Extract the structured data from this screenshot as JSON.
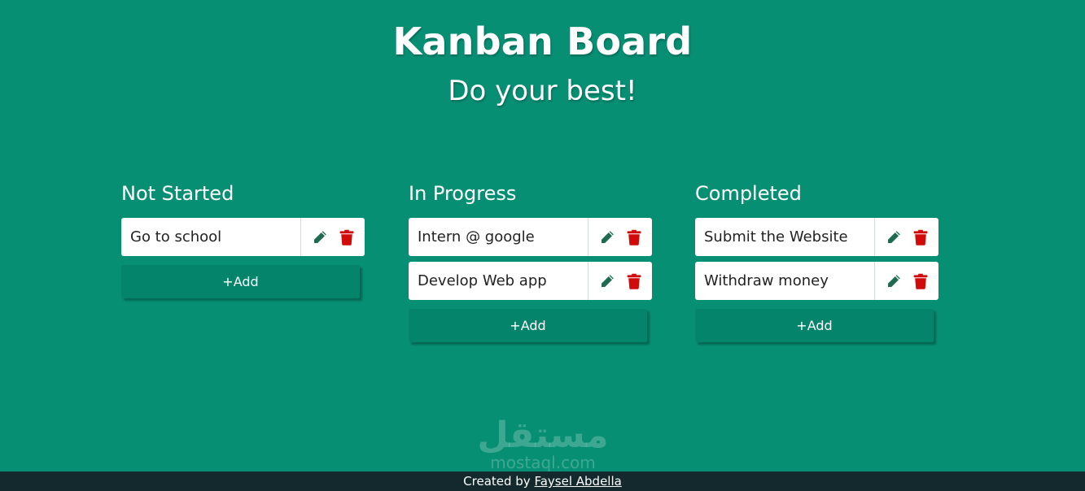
{
  "header": {
    "title": "Kanban Board",
    "subtitle": "Do your best!"
  },
  "columns": [
    {
      "title": "Not Started",
      "cards": [
        {
          "text": "Go to school"
        }
      ],
      "add_label": "+Add"
    },
    {
      "title": "In Progress",
      "cards": [
        {
          "text": "Intern @ google"
        },
        {
          "text": "Develop Web app"
        }
      ],
      "add_label": "+Add"
    },
    {
      "title": "Completed",
      "cards": [
        {
          "text": "Submit the Website"
        },
        {
          "text": "Withdraw money"
        }
      ],
      "add_label": "+Add"
    }
  ],
  "icons": {
    "edit": "pencil-icon",
    "delete": "trash-icon"
  },
  "colors": {
    "background": "#078f74",
    "add_button": "#04846a",
    "edit_icon": "#1e6b52",
    "delete_icon": "#d10a0a",
    "footer": "#13292d"
  },
  "watermark": {
    "arabic": "مستقل",
    "latin": "mostaql.com"
  },
  "footer": {
    "prefix": "Created by",
    "author": "Faysel Abdella"
  }
}
